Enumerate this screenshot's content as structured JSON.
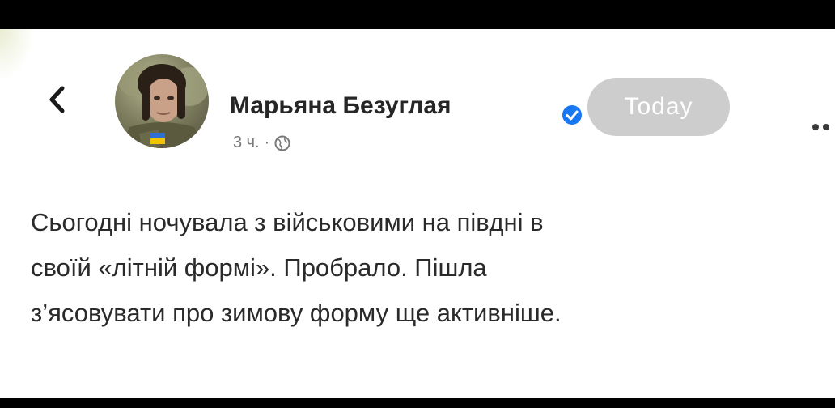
{
  "post": {
    "author": "Марьяна Безуглая",
    "badge": "Today",
    "time": "3 ч.",
    "separator": "·",
    "text_lines": [
      "Сьогодні ночувала з військовими на півдні в",
      "своїй «літній формі». Пробрало. Пішла",
      "з’ясовувати про зимову форму ще активніше."
    ]
  },
  "icons": {
    "back": "chevron-left-icon",
    "verified": "verified-badge-icon",
    "audience": "globe-icon",
    "menu": "more-dots-icon"
  },
  "colors": {
    "verified_blue": "#1877f2",
    "badge_gray": "#cdcdcd",
    "frame": "#000000"
  }
}
